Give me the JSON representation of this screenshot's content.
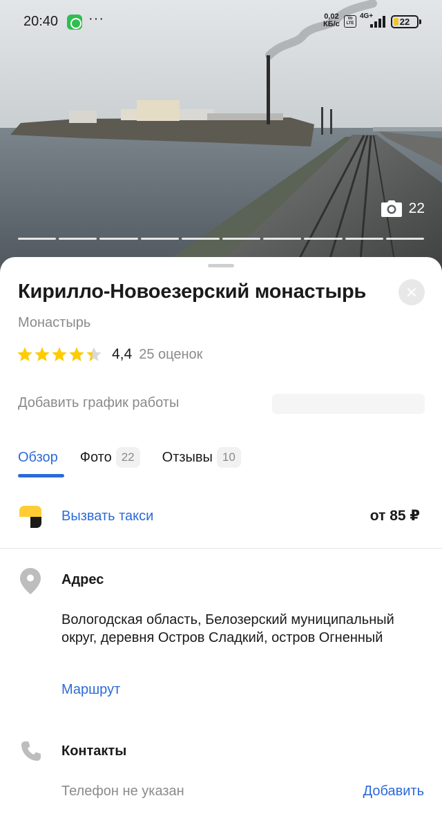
{
  "status_bar": {
    "time": "20:40",
    "dots": "···",
    "speed_value": "0,02",
    "speed_unit": "КБ/с",
    "volte": "Vo LTE",
    "network": "4G+",
    "battery": "22"
  },
  "gallery": {
    "photo_count": "22",
    "slides_total": 10,
    "camera_icon": "camera-icon"
  },
  "place": {
    "name": "Кирилло-Новоезерский монастырь",
    "category": "Монастырь",
    "rating_value": "4,4",
    "rating_stars": 4.4,
    "rating_count": "25 оценок",
    "hours_prompt": "Добавить график работы"
  },
  "tabs": [
    {
      "label": "Обзор",
      "badge": null
    },
    {
      "label": "Фото",
      "badge": "22"
    },
    {
      "label": "Отзывы",
      "badge": "10"
    }
  ],
  "taxi": {
    "label": "Вызвать такси",
    "price": "от 85 ₽"
  },
  "address": {
    "label": "Адрес",
    "text": "Вологодская область, Белозерский муниципальный округ, деревня Остров Сладкий, остров Огненный",
    "route_link": "Маршрут"
  },
  "contacts": {
    "label": "Контакты",
    "phone_status": "Телефон не указан",
    "add_link": "Добавить"
  },
  "colors": {
    "accent": "#2b6ad8",
    "star": "#ffcc00",
    "taxi_yellow": "#ffcc33",
    "muted_text": "#8a8a8a"
  }
}
